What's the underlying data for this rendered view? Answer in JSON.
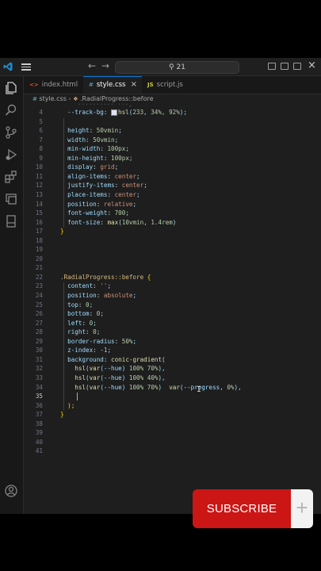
{
  "titlebar": {
    "search_text": "21"
  },
  "tabs": [
    {
      "icon": "HTML",
      "label": "index.html"
    },
    {
      "icon": "#",
      "label": "style.css"
    },
    {
      "icon": "JS",
      "label": "script.js"
    }
  ],
  "breadcrumb": {
    "file": "style.css",
    "symbol": ".RadialProgress::before"
  },
  "editor": {
    "lines": [
      {
        "n": "4",
        "text": "  --track-bg: ■hsl(233, 34%, 92%);"
      },
      {
        "n": "5",
        "text": ""
      },
      {
        "n": "6",
        "text": "  height: 50vmin;"
      },
      {
        "n": "7",
        "text": "  width: 50vmin;"
      },
      {
        "n": "8",
        "text": "  min-width: 100px;"
      },
      {
        "n": "9",
        "text": "  min-height: 100px;"
      },
      {
        "n": "10",
        "text": "  display: grid;"
      },
      {
        "n": "11",
        "text": "  align-items: center;"
      },
      {
        "n": "12",
        "text": "  justify-items: center;"
      },
      {
        "n": "13",
        "text": "  place-items: center;"
      },
      {
        "n": "14",
        "text": "  position: relative;"
      },
      {
        "n": "15",
        "text": "  font-weight: 700;"
      },
      {
        "n": "16",
        "text": "  font-size: max(10vmin, 1.4rem)"
      },
      {
        "n": "17",
        "text": "}"
      },
      {
        "n": "18",
        "text": ""
      },
      {
        "n": "19",
        "text": ""
      },
      {
        "n": "20",
        "text": ""
      },
      {
        "n": "21",
        "text": ""
      },
      {
        "n": "22",
        "text": ".RadialProgress::before {"
      },
      {
        "n": "23",
        "text": "  content: '';"
      },
      {
        "n": "24",
        "text": "  position: absolute;"
      },
      {
        "n": "25",
        "text": "  top: 0;"
      },
      {
        "n": "26",
        "text": "  bottom: 0;"
      },
      {
        "n": "27",
        "text": "  left: 0;"
      },
      {
        "n": "28",
        "text": "  right: 0;"
      },
      {
        "n": "29",
        "text": "  border-radius: 50%;"
      },
      {
        "n": "30",
        "text": "  z-index: -1;"
      },
      {
        "n": "31",
        "text": "  background: conic-gradient("
      },
      {
        "n": "32",
        "text": "    hsl(var(--hue) 100% 70%),"
      },
      {
        "n": "33",
        "text": "    hsl(var(--hue) 100% 40%),"
      },
      {
        "n": "34",
        "text": "    hsl(var(--hue) 100% 70%)  var(--progress, 0%),"
      },
      {
        "n": "35",
        "text": ""
      },
      {
        "n": "36",
        "text": "  );"
      },
      {
        "n": "37",
        "text": "}"
      },
      {
        "n": "38",
        "text": ""
      },
      {
        "n": "39",
        "text": ""
      },
      {
        "n": "40",
        "text": ""
      },
      {
        "n": "41",
        "text": ""
      }
    ]
  },
  "subscribe": {
    "label": "SUBSCRIBE",
    "plus": "+"
  },
  "colors": {
    "accent": "#0078d4",
    "subscribe": "#cc1515",
    "property": "#9cdcfe",
    "value": "#ce9178",
    "number": "#b5cea8",
    "selector": "#d7ba7d",
    "brace": "#ffd700",
    "function": "#dcdcaa"
  }
}
